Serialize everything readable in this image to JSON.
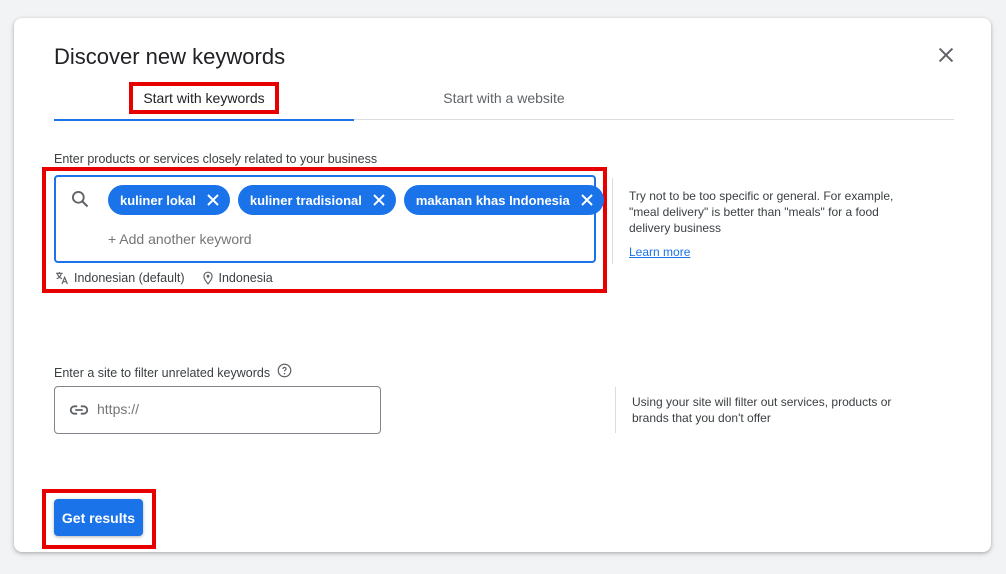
{
  "dialog": {
    "title": "Discover new keywords"
  },
  "tabs": [
    {
      "label": "Start with keywords",
      "active": true
    },
    {
      "label": "Start with a website",
      "active": false
    }
  ],
  "keywords_section": {
    "label": "Enter products or services closely related to your business",
    "chips": [
      "kuliner lokal",
      "kuliner tradisional",
      "makanan khas Indonesia"
    ],
    "add_placeholder": "+ Add another keyword",
    "language": "Indonesian (default)",
    "location": "Indonesia",
    "tip": "Try not to be too specific or general. For example, \"meal delivery\" is better than \"meals\" for a food delivery business",
    "learn_more": "Learn more"
  },
  "site_section": {
    "label": "Enter a site to filter unrelated keywords",
    "placeholder": "https://",
    "note": "Using your site will filter out services, products or brands that you don't offer"
  },
  "actions": {
    "submit_label": "Get results"
  },
  "colors": {
    "accent": "#1a73e8",
    "highlight": "#e60000"
  }
}
